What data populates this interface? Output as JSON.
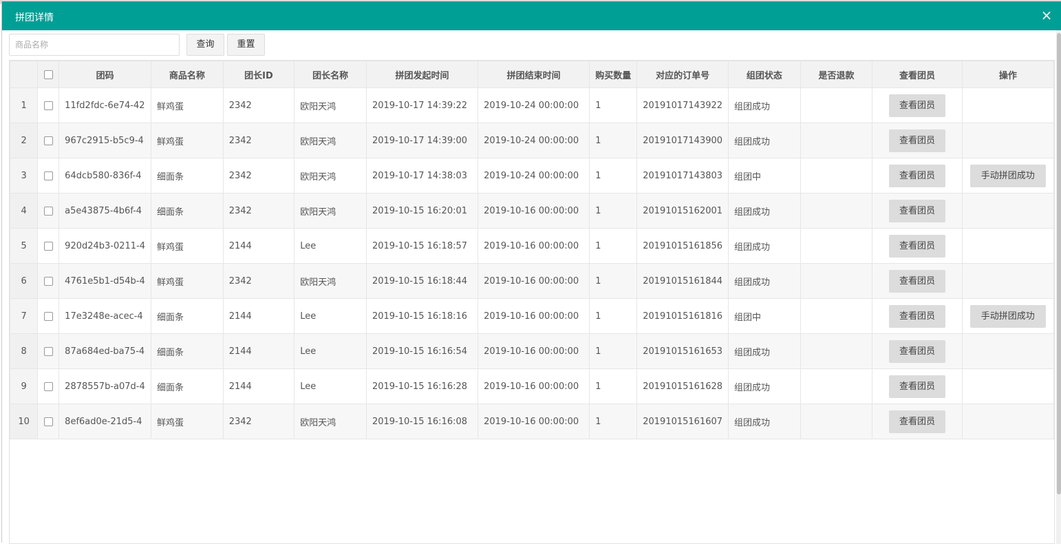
{
  "dialog": {
    "title": "拼团详情",
    "close_icon": "×"
  },
  "search": {
    "placeholder": "商品名称",
    "value": ""
  },
  "toolbar": {
    "query_label": "查询",
    "reset_label": "重置"
  },
  "table": {
    "headers": [
      "团码",
      "商品名称",
      "团长ID",
      "团长名称",
      "拼团发起时间",
      "拼团结束时间",
      "购买数量",
      "对应的订单号",
      "组团状态",
      "是否退款",
      "查看团员",
      "操作"
    ],
    "rows": [
      {
        "index": "1",
        "code": "11fd2fdc-6e74-42",
        "product": "鲜鸡蛋",
        "leader_id": "2342",
        "leader_name": "欧阳天鸿",
        "start": "2019-10-17 14:39:22",
        "end": "2019-10-24 00:00:00",
        "qty": "1",
        "order": "20191017143922",
        "status": "组团成功",
        "refund": "",
        "view": "查看团员",
        "action": ""
      },
      {
        "index": "2",
        "code": "967c2915-b5c9-4",
        "product": "鲜鸡蛋",
        "leader_id": "2342",
        "leader_name": "欧阳天鸿",
        "start": "2019-10-17 14:39:00",
        "end": "2019-10-24 00:00:00",
        "qty": "1",
        "order": "20191017143900",
        "status": "组团成功",
        "refund": "",
        "view": "查看团员",
        "action": ""
      },
      {
        "index": "3",
        "code": "64dcb580-836f-4",
        "product": "细面条",
        "leader_id": "2342",
        "leader_name": "欧阳天鸿",
        "start": "2019-10-17 14:38:03",
        "end": "2019-10-24 00:00:00",
        "qty": "1",
        "order": "20191017143803",
        "status": "组团中",
        "refund": "",
        "view": "查看团员",
        "action": "手动拼团成功"
      },
      {
        "index": "4",
        "code": "a5e43875-4b6f-4",
        "product": "细面条",
        "leader_id": "2342",
        "leader_name": "欧阳天鸿",
        "start": "2019-10-15 16:20:01",
        "end": "2019-10-16 00:00:00",
        "qty": "1",
        "order": "20191015162001",
        "status": "组团成功",
        "refund": "",
        "view": "查看团员",
        "action": ""
      },
      {
        "index": "5",
        "code": "920d24b3-0211-4",
        "product": "鲜鸡蛋",
        "leader_id": "2144",
        "leader_name": "Lee",
        "start": "2019-10-15 16:18:57",
        "end": "2019-10-16 00:00:00",
        "qty": "1",
        "order": "20191015161856",
        "status": "组团成功",
        "refund": "",
        "view": "查看团员",
        "action": ""
      },
      {
        "index": "6",
        "code": "4761e5b1-d54b-4",
        "product": "鲜鸡蛋",
        "leader_id": "2342",
        "leader_name": "欧阳天鸿",
        "start": "2019-10-15 16:18:44",
        "end": "2019-10-16 00:00:00",
        "qty": "1",
        "order": "20191015161844",
        "status": "组团成功",
        "refund": "",
        "view": "查看团员",
        "action": ""
      },
      {
        "index": "7",
        "code": "17e3248e-acec-4",
        "product": "细面条",
        "leader_id": "2144",
        "leader_name": "Lee",
        "start": "2019-10-15 16:18:16",
        "end": "2019-10-16 00:00:00",
        "qty": "1",
        "order": "20191015161816",
        "status": "组团中",
        "refund": "",
        "view": "查看团员",
        "action": "手动拼团成功"
      },
      {
        "index": "8",
        "code": "87a684ed-ba75-4",
        "product": "细面条",
        "leader_id": "2144",
        "leader_name": "Lee",
        "start": "2019-10-15 16:16:54",
        "end": "2019-10-16 00:00:00",
        "qty": "1",
        "order": "20191015161653",
        "status": "组团成功",
        "refund": "",
        "view": "查看团员",
        "action": ""
      },
      {
        "index": "9",
        "code": "2878557b-a07d-4",
        "product": "细面条",
        "leader_id": "2144",
        "leader_name": "Lee",
        "start": "2019-10-15 16:16:28",
        "end": "2019-10-16 00:00:00",
        "qty": "1",
        "order": "20191015161628",
        "status": "组团成功",
        "refund": "",
        "view": "查看团员",
        "action": ""
      },
      {
        "index": "10",
        "code": "8ef6ad0e-21d5-4",
        "product": "鲜鸡蛋",
        "leader_id": "2342",
        "leader_name": "欧阳天鸿",
        "start": "2019-10-15 16:16:08",
        "end": "2019-10-16 00:00:00",
        "qty": "1",
        "order": "20191015161607",
        "status": "组团成功",
        "refund": "",
        "view": "查看团员",
        "action": ""
      }
    ]
  },
  "colors": {
    "titlebar": "#009f95",
    "header_bg": "#f2f2f2",
    "button_bg": "#dcdcdc"
  }
}
